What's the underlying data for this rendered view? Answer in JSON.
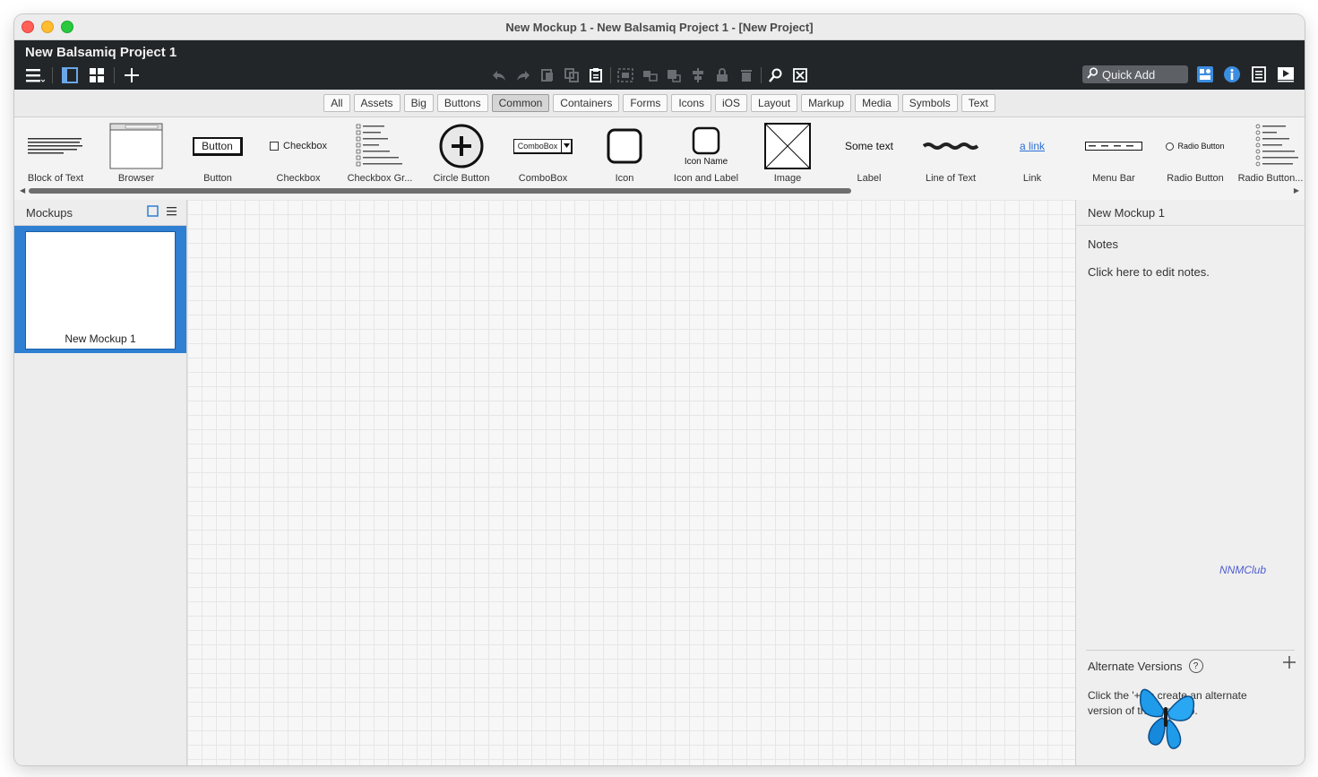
{
  "window": {
    "title": "New Mockup 1 - New Balsamiq Project 1 - [New Project]"
  },
  "app": {
    "project_name": "New Balsamiq Project 1",
    "quick_add_placeholder": "Quick Add",
    "accent_color": "#2f7fd2",
    "header_color": "#222629"
  },
  "toolbar": {
    "left_icons": [
      "menu-icon",
      "single-view-icon",
      "grid-view-icon",
      "add-icon"
    ],
    "center_icons": [
      "undo-icon",
      "redo-icon",
      "cut-icon",
      "copy-icon",
      "paste-icon",
      "group-icon",
      "ungroup-icon",
      "bring-front-icon",
      "align-icon",
      "lock-icon",
      "delete-icon",
      "find-icon",
      "clear-icon"
    ],
    "right_icons": [
      "search-icon",
      "assets-icon",
      "info-icon",
      "notes-icon",
      "present-icon"
    ]
  },
  "categories": {
    "items": [
      "All",
      "Assets",
      "Big",
      "Buttons",
      "Common",
      "Containers",
      "Forms",
      "Icons",
      "iOS",
      "Layout",
      "Markup",
      "Media",
      "Symbols",
      "Text"
    ],
    "active": "Common"
  },
  "library": {
    "items": [
      {
        "label": "Block of Text"
      },
      {
        "label": "Browser"
      },
      {
        "label": "Button",
        "sample": "Button"
      },
      {
        "label": "Checkbox",
        "sample": "Checkbox"
      },
      {
        "label": "Checkbox Gr..."
      },
      {
        "label": "Circle Button"
      },
      {
        "label": "ComboBox",
        "sample": "ComboBox"
      },
      {
        "label": "Icon"
      },
      {
        "label": "Icon and Label",
        "sample": "Icon Name"
      },
      {
        "label": "Image"
      },
      {
        "label": "Label",
        "sample": "Some text"
      },
      {
        "label": "Line of Text"
      },
      {
        "label": "Link",
        "sample": "a link"
      },
      {
        "label": "Menu Bar"
      },
      {
        "label": "Radio Button",
        "sample": "Radio Button"
      },
      {
        "label": "Radio Button..."
      }
    ]
  },
  "mockups": {
    "title": "Mockups",
    "items": [
      {
        "name": "New Mockup 1",
        "selected": true
      }
    ]
  },
  "inspector": {
    "title": "New Mockup 1",
    "notes_label": "Notes",
    "notes_placeholder": "Click here to edit notes.",
    "watermark": "NNMClub",
    "alternate_versions_label": "Alternate Versions",
    "alternate_versions_text": "Click the '+' to create an alternate version of this mockup."
  }
}
